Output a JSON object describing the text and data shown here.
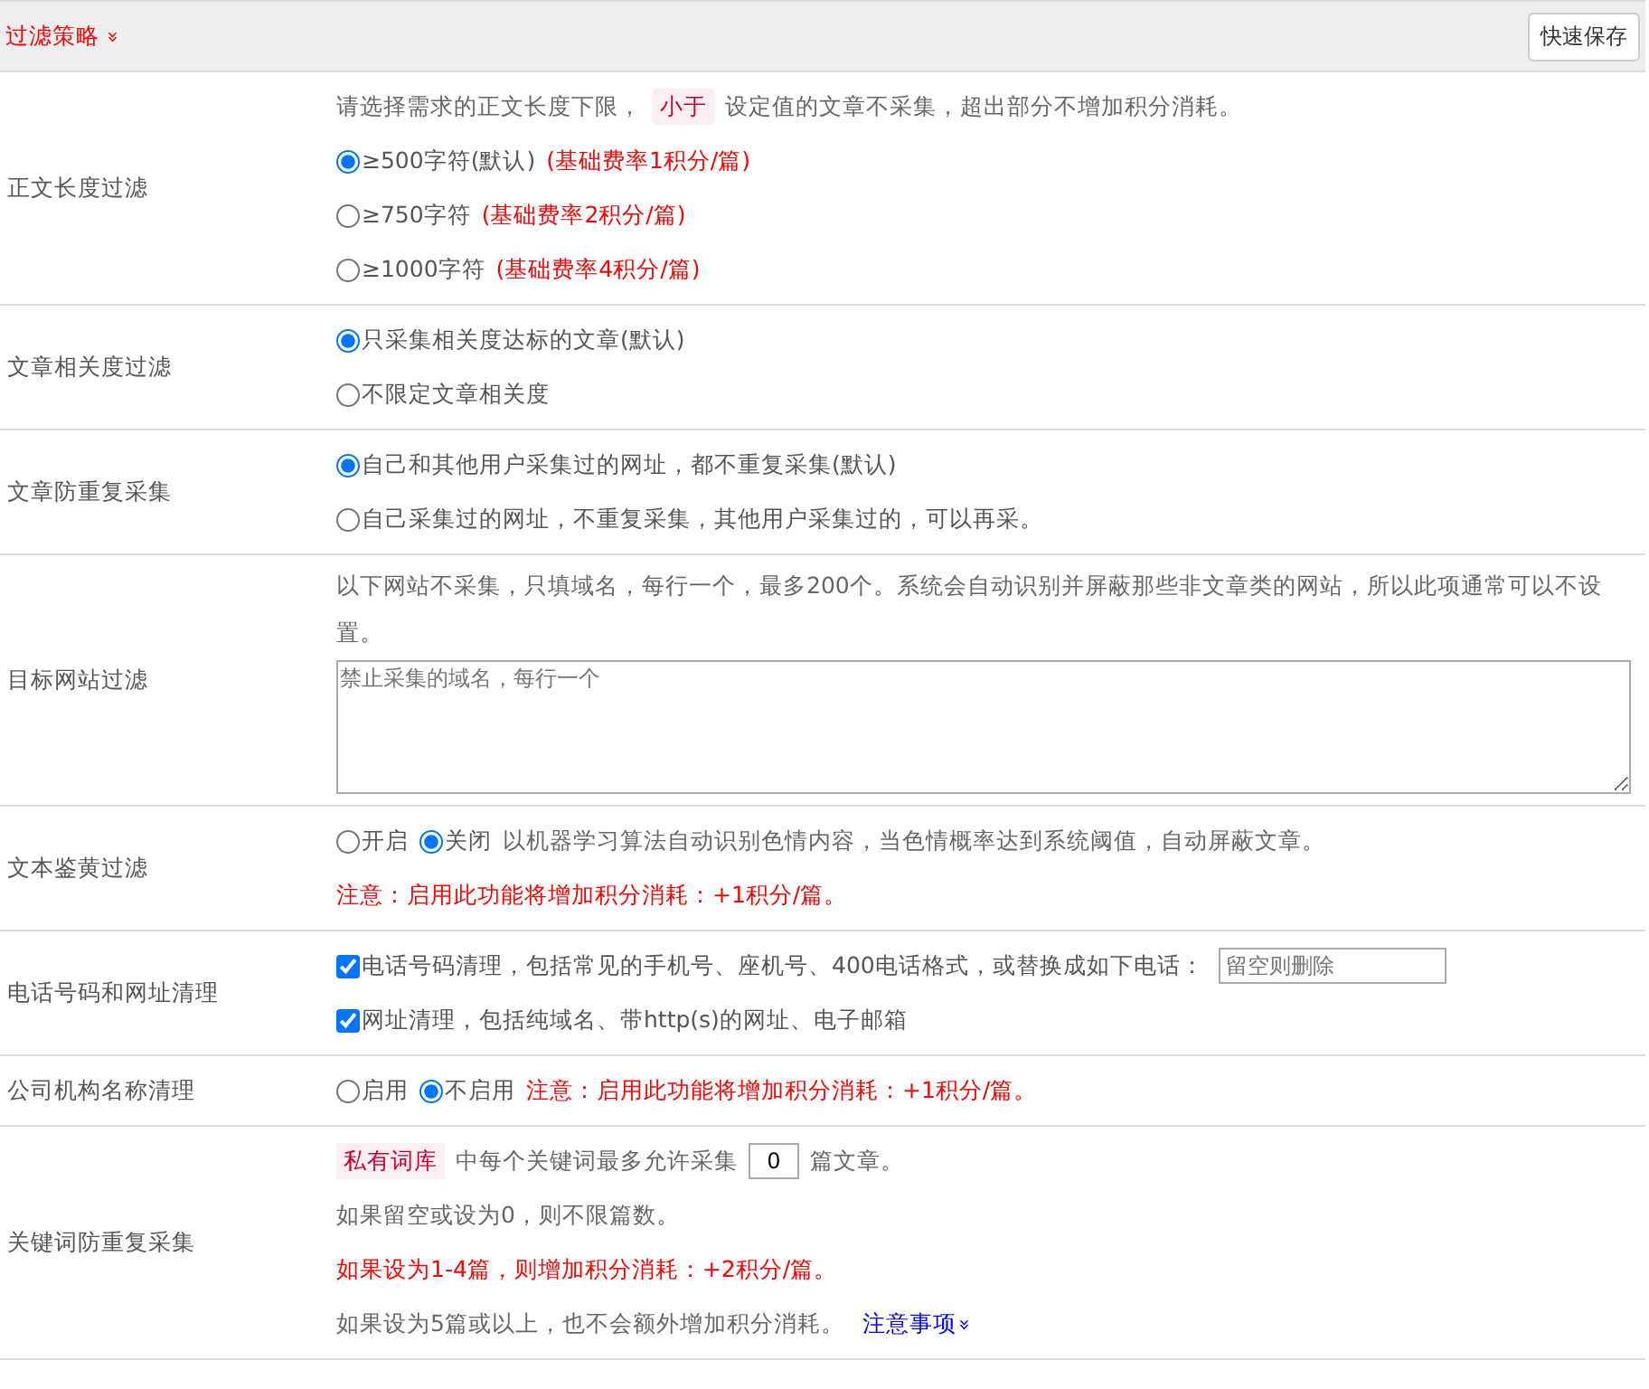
{
  "header": {
    "title": "过滤策略",
    "toggle": "»",
    "save_button": "快速保存"
  },
  "rows": [
    {
      "label": "正文长度过滤",
      "lines": [
        [
          {
            "kind": "text",
            "text": "请选择需求的正文长度下限，"
          },
          {
            "kind": "tag",
            "text": "小于"
          },
          {
            "kind": "text",
            "text": "设定值的文章不采集，超出部分不增加积分消耗。"
          }
        ],
        [
          {
            "kind": "radio",
            "text": "≥500字符(默认)",
            "selected": true
          },
          {
            "kind": "note",
            "text": "(基础费率1积分/篇)"
          }
        ],
        [
          {
            "kind": "radio",
            "text": "≥750字符",
            "selected": false
          },
          {
            "kind": "note",
            "text": "(基础费率2积分/篇)"
          }
        ],
        [
          {
            "kind": "radio",
            "text": "≥1000字符",
            "selected": false
          },
          {
            "kind": "note",
            "text": "(基础费率4积分/篇)"
          }
        ]
      ]
    },
    {
      "label": "文章相关度过滤",
      "lines": [
        [
          {
            "kind": "radio",
            "text": "只采集相关度达标的文章(默认)",
            "selected": true
          }
        ],
        [
          {
            "kind": "radio",
            "text": "不限定文章相关度",
            "selected": false
          }
        ]
      ]
    },
    {
      "label": "文章防重复采集",
      "lines": [
        [
          {
            "kind": "radio",
            "text": "自己和其他用户采集过的网址，都不重复采集(默认)",
            "selected": true
          }
        ],
        [
          {
            "kind": "radio",
            "text": "自己采集过的网址，不重复采集，其他用户采集过的，可以再采。",
            "selected": false
          }
        ]
      ]
    },
    {
      "label": "目标网站过滤",
      "lines": [
        [
          {
            "kind": "text",
            "text": "以下网站不采集，只填域名，每行一个，最多200个。系统会自动识别并屏蔽那些非文章类的网站，所以此项通常可以不设置。"
          }
        ],
        [
          {
            "kind": "textarea",
            "placeholder": "禁止采集的域名，每行一个"
          }
        ]
      ]
    },
    {
      "label": "文本鉴黄过滤",
      "lines": [
        [
          {
            "kind": "radio",
            "text": "开启",
            "selected": false
          },
          {
            "kind": "radio",
            "text": "关闭",
            "selected": true
          },
          {
            "kind": "text",
            "text": "以机器学习算法自动识别色情内容，当色情概率达到系统阈值，自动屏蔽文章。"
          }
        ],
        [
          {
            "kind": "note",
            "text": "注意：启用此功能将增加积分消耗：+1积分/篇。"
          }
        ]
      ]
    },
    {
      "label": "电话号码和网址清理",
      "lines": [
        [
          {
            "kind": "checkbox",
            "text": "电话号码清理，包括常见的手机号、座机号、400电话格式，或替换成如下电话：",
            "checked": true
          },
          {
            "kind": "input",
            "placeholder": "留空则删除"
          }
        ],
        [
          {
            "kind": "checkbox",
            "text": "网址清理，包括纯域名、带http(s)的网址、电子邮箱",
            "checked": true
          }
        ]
      ]
    },
    {
      "label": "公司机构名称清理",
      "lines": [
        [
          {
            "kind": "radio",
            "text": "启用",
            "selected": false
          },
          {
            "kind": "radio",
            "text": "不启用",
            "selected": true
          },
          {
            "kind": "note",
            "text": "注意：启用此功能将增加积分消耗：+1积分/篇。"
          }
        ]
      ]
    },
    {
      "label": "关键词防重复采集",
      "lines": [
        [
          {
            "kind": "tag",
            "text": "私有词库"
          },
          {
            "kind": "text",
            "text": "中每个关键词最多允许采集"
          },
          {
            "kind": "number",
            "value": "0"
          },
          {
            "kind": "text",
            "text": "篇文章。"
          }
        ],
        [
          {
            "kind": "text",
            "text": "如果留空或设为0，则不限篇数。"
          }
        ],
        [
          {
            "kind": "note",
            "text": "如果设为1-4篇，则增加积分消耗：+2积分/篇。"
          }
        ],
        [
          {
            "kind": "text",
            "text": "如果设为5篇或以上，也不会额外增加积分消耗。"
          },
          {
            "kind": "link",
            "text": "注意事项",
            "toggle": "»"
          }
        ]
      ]
    }
  ]
}
